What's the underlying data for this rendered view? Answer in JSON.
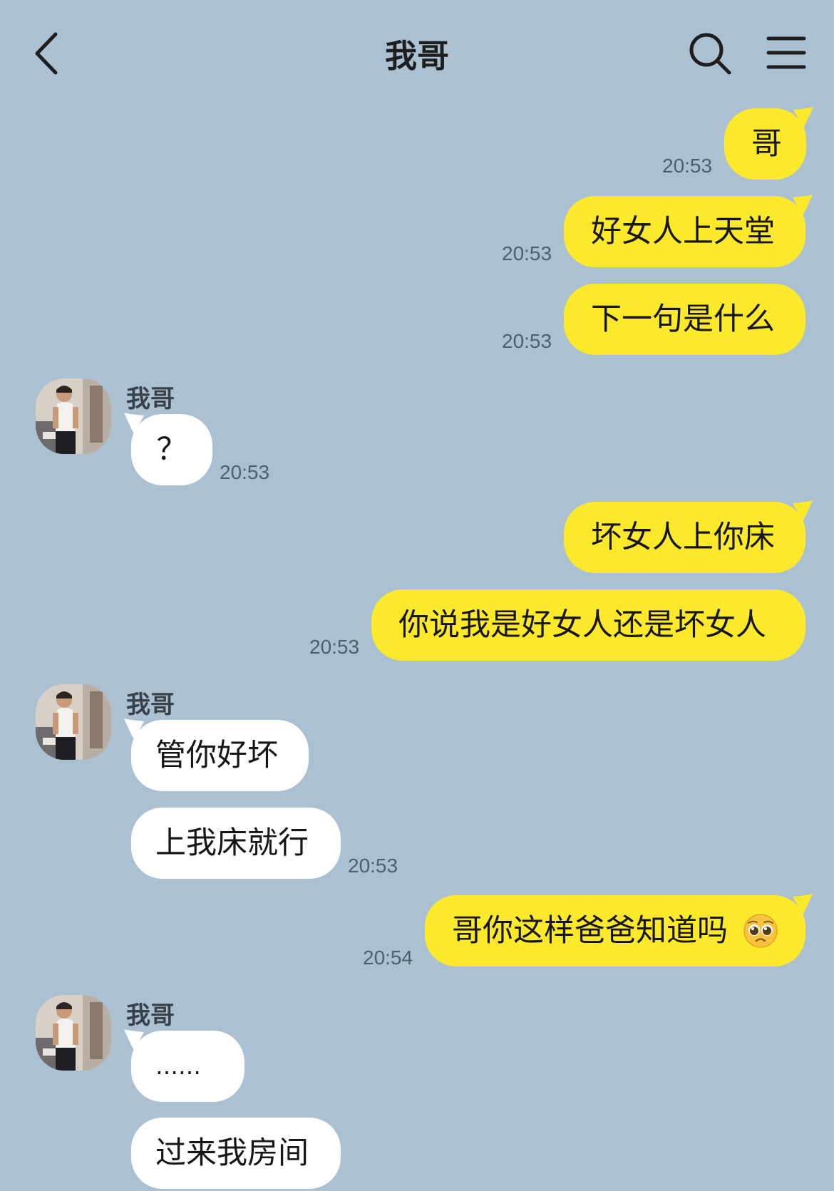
{
  "header": {
    "title": "我哥"
  },
  "icons": {
    "back": "chevron-left-icon",
    "search": "search-icon",
    "menu": "menu-icon"
  },
  "colors": {
    "background": "#abc1d1",
    "outgoing_bubble": "#fde92b",
    "incoming_bubble": "#ffffff"
  },
  "contact": {
    "name": "我哥"
  },
  "messages": [
    {
      "dir": "out",
      "text": "哥",
      "time": "20:53"
    },
    {
      "dir": "out",
      "text": "好女人上天堂",
      "time": "20:53"
    },
    {
      "dir": "out",
      "text": "下一句是什么",
      "time": "20:53"
    },
    {
      "dir": "in",
      "sender": "我哥",
      "text": "？",
      "time": "20:53"
    },
    {
      "dir": "out",
      "text": "坏女人上你床",
      "time": ""
    },
    {
      "dir": "out",
      "text": "你说我是好女人还是坏女人",
      "time": "20:53"
    },
    {
      "dir": "in",
      "sender": "我哥",
      "text": "管你好坏",
      "time": ""
    },
    {
      "dir": "in",
      "text": "上我床就行",
      "time": "20:53"
    },
    {
      "dir": "out",
      "text": "哥你这样爸爸知道吗",
      "emoji": "pleading-face-emoji",
      "time": "20:54"
    },
    {
      "dir": "in",
      "sender": "我哥",
      "text": "……",
      "time": ""
    },
    {
      "dir": "in",
      "text": "过来我房间",
      "time": ""
    }
  ]
}
